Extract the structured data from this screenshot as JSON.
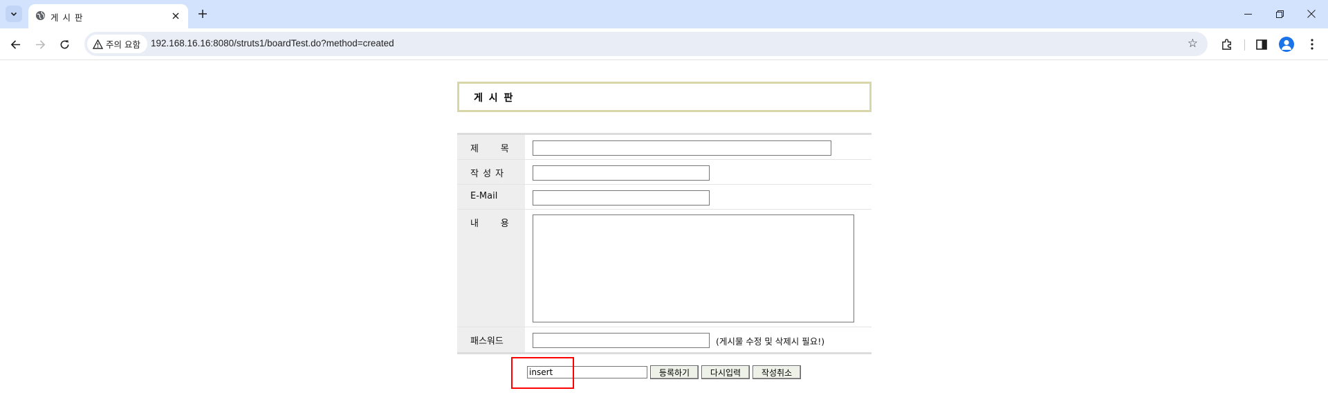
{
  "browser": {
    "tab": {
      "title": "게 시 판",
      "favicon": "globe-icon"
    },
    "window_controls": [
      "minimize-icon",
      "restore-icon",
      "close-icon"
    ],
    "security_chip": "주의 요함",
    "url": "192.168.16.16:8080/struts1/boardTest.do?method=created"
  },
  "page": {
    "header_title": "게 시 판",
    "form": {
      "subject_label": "제      목",
      "author_label": "작 성 자",
      "email_label": "E-Mail",
      "content_label": "내      용",
      "password_label": "패스워드",
      "password_hint": "(게시물 수정 및 삭제시 필요!)"
    },
    "actions": {
      "method_value": "insert",
      "submit_label": "등록하기",
      "reset_label": "다시입력",
      "cancel_label": "작성취소"
    }
  },
  "colors": {
    "tabbar_bg": "#d3e3fd",
    "header_border": "#d9d7a9",
    "label_bg": "#eeeeee",
    "highlight": "#ff0000"
  }
}
